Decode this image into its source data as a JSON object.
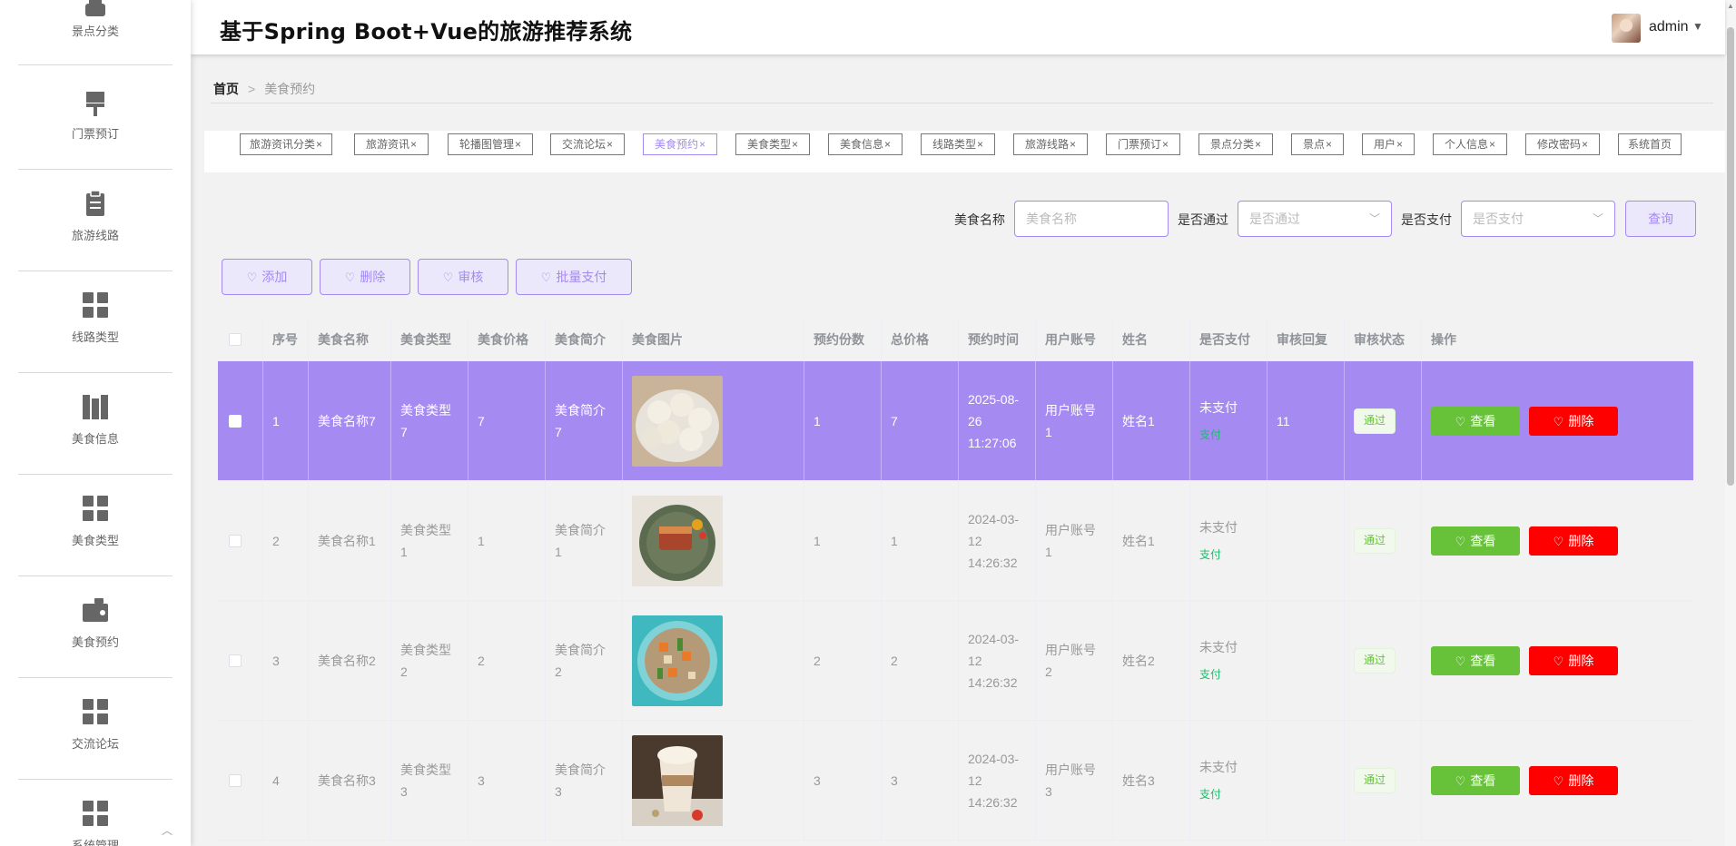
{
  "header": {
    "title": "基于Spring Boot+Vue的旅游推荐系统",
    "user": "admin"
  },
  "sidebar": {
    "items": [
      {
        "label": "景点分类",
        "icon": "shop-icon"
      },
      {
        "label": "门票预订",
        "icon": "brush-icon"
      },
      {
        "label": "旅游线路",
        "icon": "clipboard-icon"
      },
      {
        "label": "线路类型",
        "icon": "grid-icon"
      },
      {
        "label": "美食信息",
        "icon": "book-icon"
      },
      {
        "label": "美食类型",
        "icon": "grid-icon"
      },
      {
        "label": "美食预约",
        "icon": "wallet-icon"
      },
      {
        "label": "交流论坛",
        "icon": "grid-icon"
      },
      {
        "label": "系统管理",
        "icon": "grid-icon"
      }
    ]
  },
  "breadcrumb": {
    "home": "首页",
    "sep": ">",
    "current": "美食预约"
  },
  "tags": [
    {
      "label": "旅游资讯分类",
      "close": "×"
    },
    {
      "label": "旅游资讯",
      "close": "×"
    },
    {
      "label": "轮播图管理",
      "close": "×"
    },
    {
      "label": "交流论坛",
      "close": "×"
    },
    {
      "label": "美食预约",
      "close": "×",
      "active": true
    },
    {
      "label": "美食类型",
      "close": "×"
    },
    {
      "label": "美食信息",
      "close": "×"
    },
    {
      "label": "线路类型",
      "close": "×"
    },
    {
      "label": "旅游线路",
      "close": "×"
    },
    {
      "label": "门票预订",
      "close": "×"
    },
    {
      "label": "景点分类",
      "close": "×"
    },
    {
      "label": "景点",
      "close": "×"
    },
    {
      "label": "用户",
      "close": "×"
    },
    {
      "label": "个人信息",
      "close": "×"
    },
    {
      "label": "修改密码",
      "close": "×"
    },
    {
      "label": "系统首页",
      "close": ""
    }
  ],
  "search": {
    "name_label": "美食名称",
    "name_placeholder": "美食名称",
    "pass_label": "是否通过",
    "pass_placeholder": "是否通过",
    "pay_label": "是否支付",
    "pay_placeholder": "是否支付",
    "query_label": "查询"
  },
  "actions": {
    "add": "添加",
    "delete": "删除",
    "review": "审核",
    "batch_pay": "批量支付"
  },
  "table": {
    "headers": [
      "序号",
      "美食名称",
      "美食类型",
      "美食价格",
      "美食简介",
      "美食图片",
      "预约份数",
      "总价格",
      "预约时间",
      "用户账号",
      "姓名",
      "是否支付",
      "审核回复",
      "审核状态",
      "操作"
    ],
    "rows": [
      {
        "index": "1",
        "name": "美食名称7",
        "type": "美食类型7",
        "price": "7",
        "intro": "美食简介7",
        "count": "1",
        "total": "7",
        "time": "2025-08-26 11:27:06",
        "account": "用户账号1",
        "person": "姓名1",
        "paid": "未支付",
        "pay_link": "支付",
        "reply": "11",
        "status": "通过",
        "view": "查看",
        "del": "删除",
        "selected": true
      },
      {
        "index": "2",
        "name": "美食名称1",
        "type": "美食类型1",
        "price": "1",
        "intro": "美食简介1",
        "count": "1",
        "total": "1",
        "time": "2024-03-12 14:26:32",
        "account": "用户账号1",
        "person": "姓名1",
        "paid": "未支付",
        "pay_link": "支付",
        "reply": "",
        "status": "通过",
        "view": "查看",
        "del": "删除"
      },
      {
        "index": "3",
        "name": "美食名称2",
        "type": "美食类型2",
        "price": "2",
        "intro": "美食简介2",
        "count": "2",
        "total": "2",
        "time": "2024-03-12 14:26:32",
        "account": "用户账号2",
        "person": "姓名2",
        "paid": "未支付",
        "pay_link": "支付",
        "reply": "",
        "status": "通过",
        "view": "查看",
        "del": "删除"
      },
      {
        "index": "4",
        "name": "美食名称3",
        "type": "美食类型3",
        "price": "3",
        "intro": "美食简介3",
        "count": "3",
        "total": "3",
        "time": "2024-03-12 14:26:32",
        "account": "用户账号3",
        "person": "姓名3",
        "paid": "未支付",
        "pay_link": "支付",
        "reply": "",
        "status": "通过",
        "view": "查看",
        "del": "删除"
      }
    ]
  },
  "colors": {
    "accent": "#a48af1",
    "success": "#67c23a",
    "danger": "#ff0000"
  }
}
